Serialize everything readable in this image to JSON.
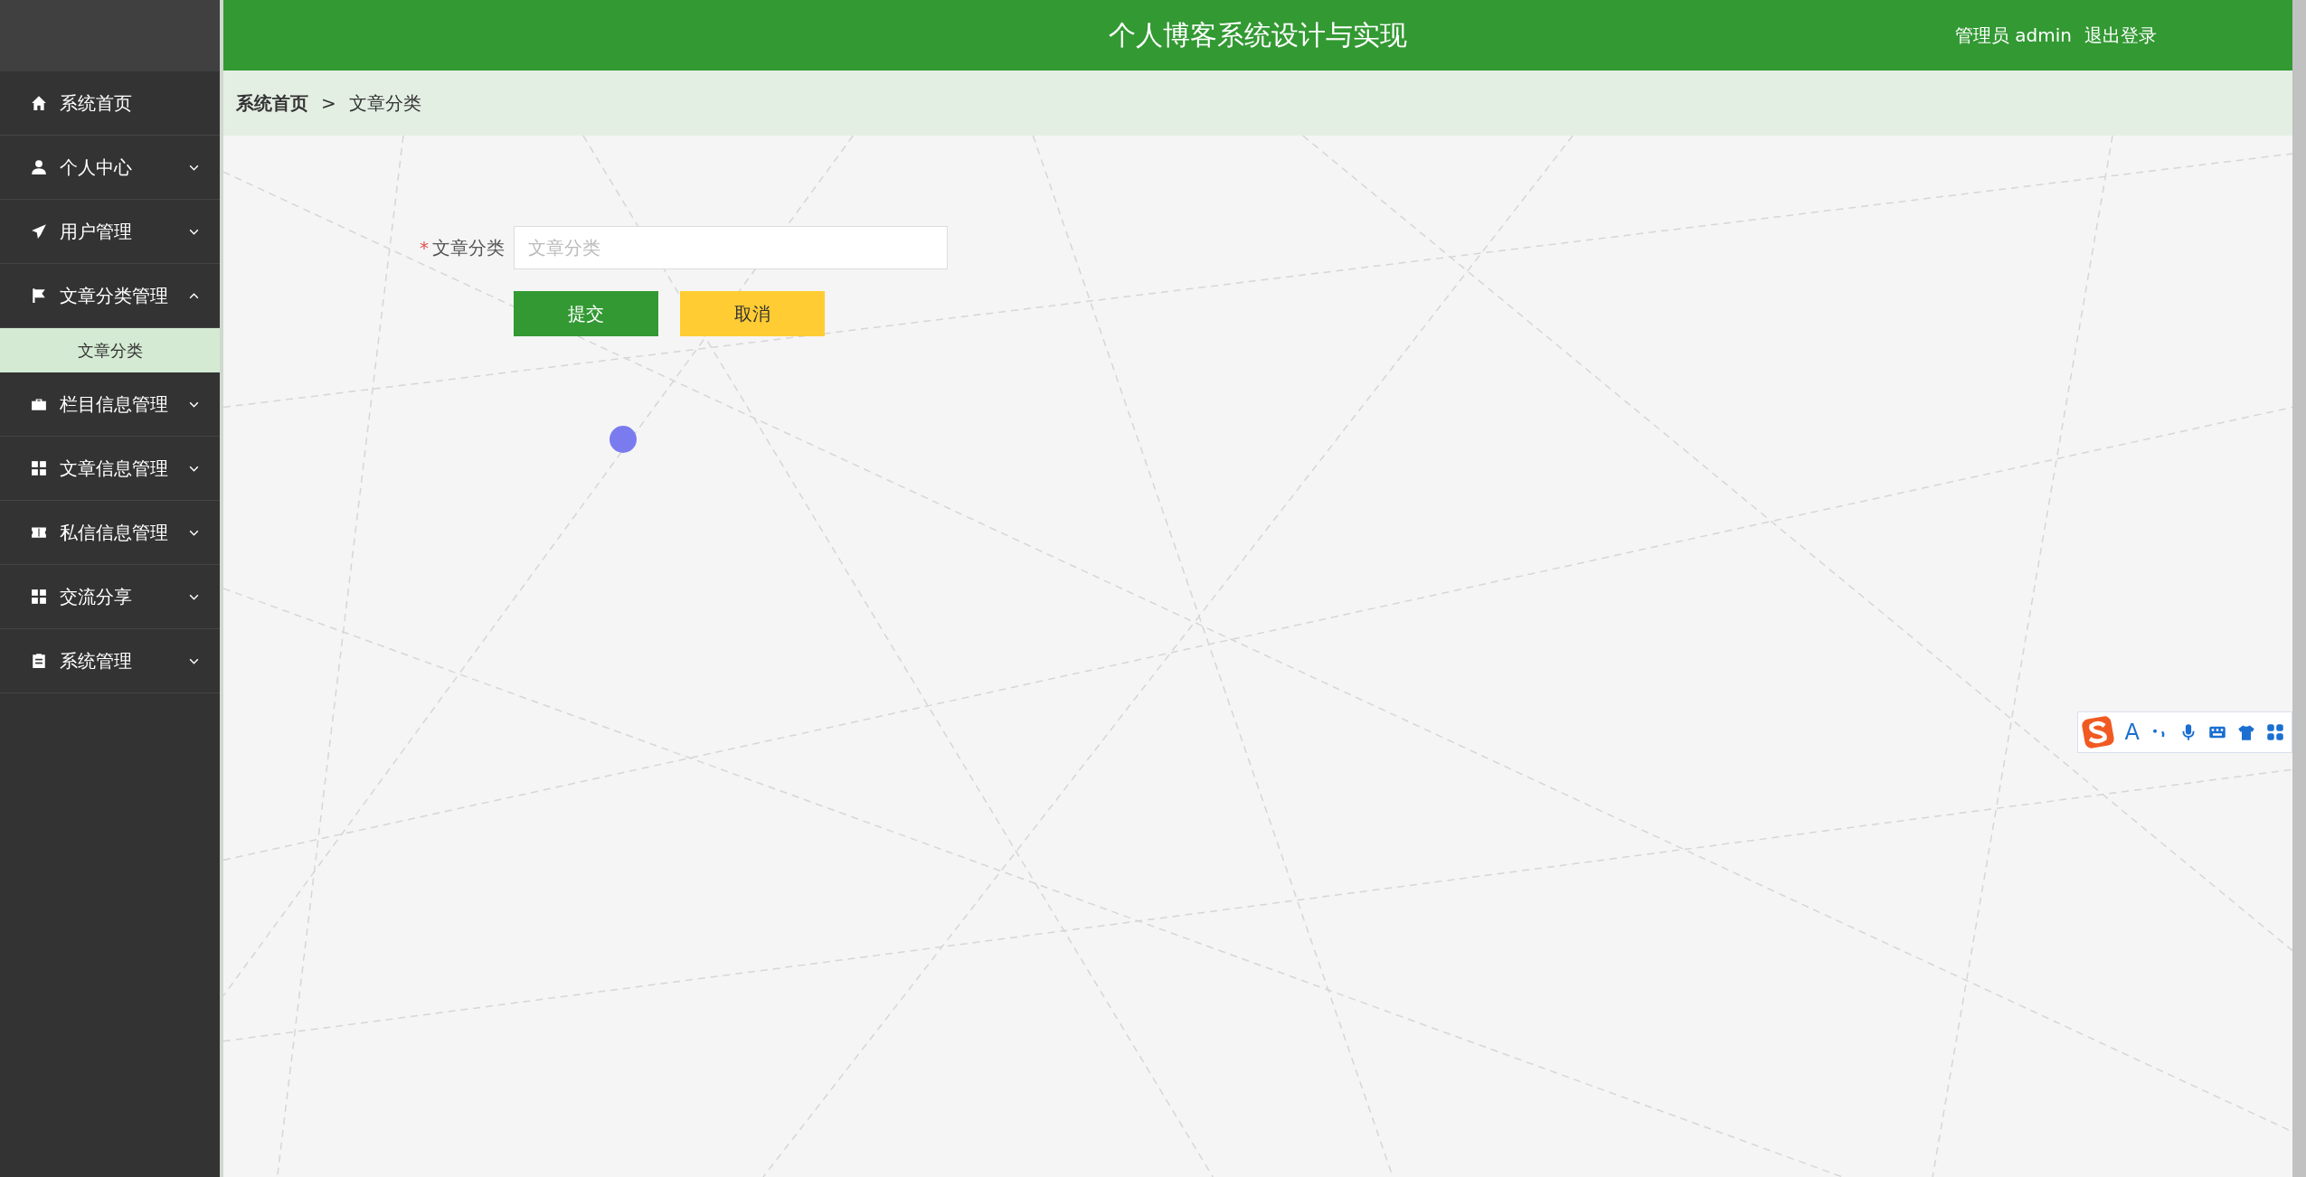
{
  "header": {
    "title": "个人博客系统设计与实现",
    "user_label": "管理员 admin",
    "logout": "退出登录"
  },
  "sidebar": {
    "items": [
      {
        "label": "系统首页",
        "kind": "link"
      },
      {
        "label": "个人中心",
        "kind": "menu",
        "expanded": false
      },
      {
        "label": "用户管理",
        "kind": "menu",
        "expanded": false
      },
      {
        "label": "文章分类管理",
        "kind": "menu",
        "expanded": true,
        "children": [
          {
            "label": "文章分类",
            "selected": true
          }
        ]
      },
      {
        "label": "栏目信息管理",
        "kind": "menu",
        "expanded": false
      },
      {
        "label": "文章信息管理",
        "kind": "menu",
        "expanded": false
      },
      {
        "label": "私信信息管理",
        "kind": "menu",
        "expanded": false
      },
      {
        "label": "交流分享",
        "kind": "menu",
        "expanded": false
      },
      {
        "label": "系统管理",
        "kind": "menu",
        "expanded": false
      }
    ]
  },
  "breadcrumb": {
    "home": "系统首页",
    "separator": ">",
    "current": "文章分类"
  },
  "form": {
    "fields": [
      {
        "label": "文章分类",
        "required": true,
        "required_mark": "*",
        "placeholder": "文章分类"
      }
    ],
    "buttons": [
      {
        "label": "提交",
        "kind": "primary"
      },
      {
        "label": "取消",
        "kind": "cancel"
      }
    ]
  },
  "ime_toolbar": {
    "letter": "A"
  }
}
